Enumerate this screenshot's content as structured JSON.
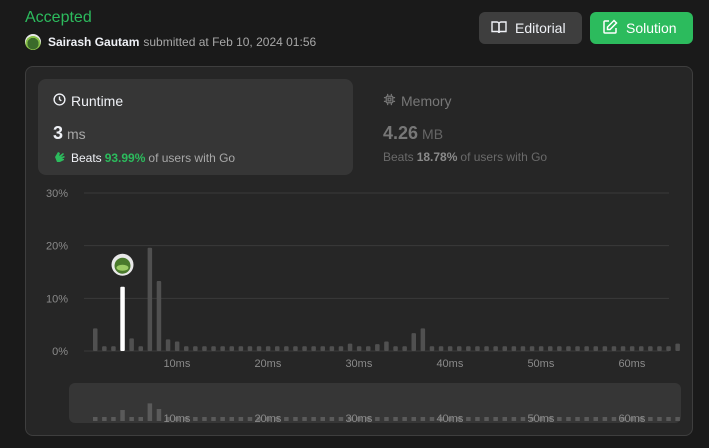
{
  "status": "Accepted",
  "submission": {
    "user": "Sairash Gautam",
    "text": "submitted at Feb 10, 2024 01:56"
  },
  "buttons": {
    "editorial": "Editorial",
    "solution": "Solution"
  },
  "runtime": {
    "title": "Runtime",
    "value": "3",
    "unit": "ms",
    "beats_prefix": "Beats",
    "beats_pct": "93.99%",
    "beats_suffix": "of users with Go"
  },
  "memory": {
    "title": "Memory",
    "value": "4.26",
    "unit": "MB",
    "beats_prefix": "Beats",
    "beats_pct": "18.78%",
    "beats_suffix": "of users with Go"
  },
  "colors": {
    "accent": "#2cbb5d",
    "bar": "#505050",
    "highlight": "#ffffff"
  },
  "chart_data": {
    "type": "bar",
    "y_ticks": [
      "30%",
      "20%",
      "10%",
      "0%"
    ],
    "ylim": [
      0,
      30
    ],
    "x_ticks": [
      "10ms",
      "20ms",
      "30ms",
      "40ms",
      "50ms",
      "60ms"
    ],
    "x_tick_values": [
      10,
      20,
      30,
      40,
      50,
      60
    ],
    "x": [
      1,
      2,
      3,
      4,
      5,
      6,
      7,
      8,
      9,
      10,
      11,
      12,
      13,
      14,
      15,
      16,
      17,
      18,
      19,
      20,
      21,
      22,
      23,
      24,
      25,
      26,
      27,
      28,
      29,
      30,
      31,
      32,
      33,
      34,
      35,
      36,
      37,
      38,
      39,
      40,
      41,
      42,
      43,
      44,
      45,
      46,
      47,
      48,
      49,
      50,
      51,
      52,
      53,
      54,
      55,
      56,
      57,
      58,
      59,
      60,
      61,
      62,
      63,
      64,
      65
    ],
    "values": [
      4.3,
      0.9,
      0.9,
      12.2,
      2.4,
      0.9,
      19.6,
      13.3,
      2.2,
      1.8,
      0.9,
      0.9,
      0.9,
      0.9,
      0.9,
      0.9,
      0.9,
      0.9,
      0.9,
      0.9,
      0.9,
      0.9,
      0.9,
      0.9,
      0.9,
      0.9,
      0.9,
      0.9,
      1.4,
      0.9,
      0.9,
      1.3,
      1.8,
      0.9,
      0.9,
      3.4,
      4.3,
      0.9,
      0.9,
      0.9,
      0.9,
      0.9,
      0.9,
      0.9,
      0.9,
      0.9,
      0.9,
      0.9,
      0.9,
      0.9,
      0.9,
      0.9,
      0.9,
      0.9,
      0.9,
      0.9,
      0.9,
      0.9,
      0.9,
      0.9,
      0.9,
      0.9,
      0.9,
      0.9,
      1.4
    ],
    "highlight_x": 4
  }
}
